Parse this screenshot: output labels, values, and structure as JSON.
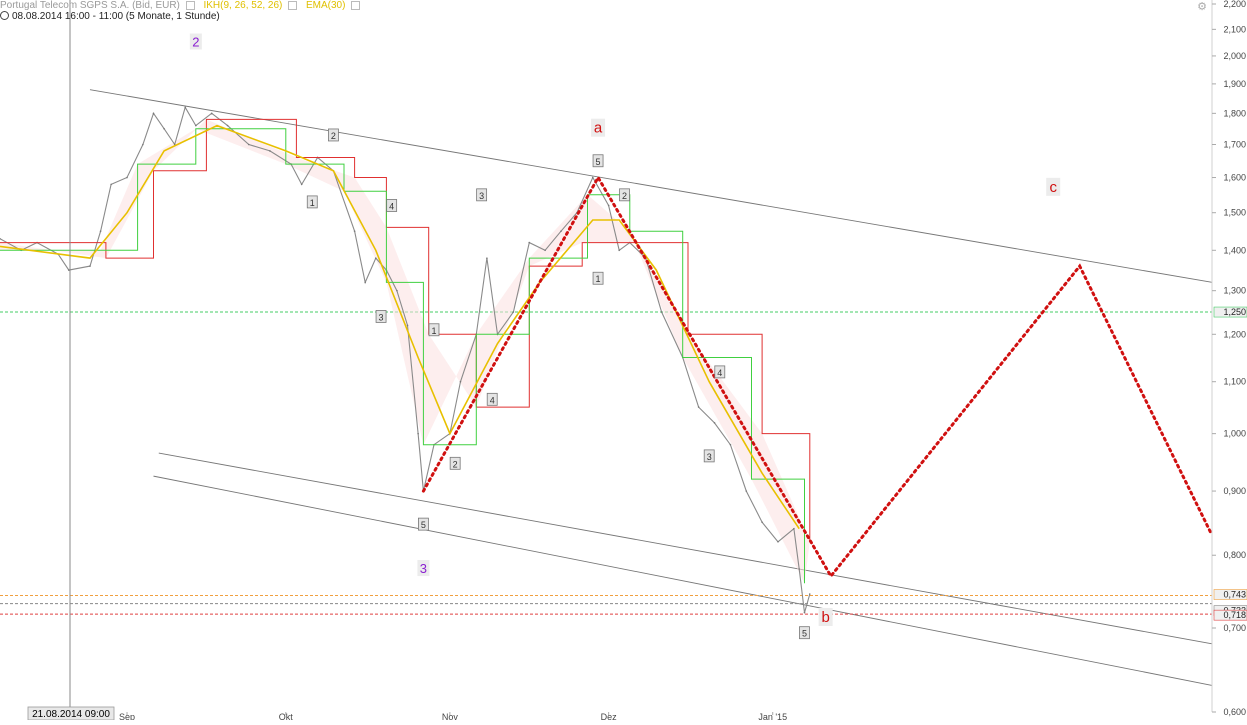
{
  "header": {
    "instrument": "Portugal Telecom SGPS S.A. (Bid, EUR)",
    "indicator_ikh": "IKH(9, 26, 52, 26)",
    "indicator_ema": "EMA(30)",
    "timeframe": "08.08.2014 16:00 - 11:00 (5 Monate, 1 Stunde)"
  },
  "cursor_date_label": "21.08.2014 09:00",
  "chart_data": {
    "type": "line",
    "title": "",
    "x_start": "2014-08-08",
    "x_end": "2015-03-25",
    "y_scale": "log",
    "ylim": [
      0.6,
      2.2
    ],
    "x_ticks": [
      {
        "date": "2014-09-01",
        "label": "Sep"
      },
      {
        "date": "2014-10-01",
        "label": "Okt"
      },
      {
        "date": "2014-11-01",
        "label": "Nov"
      },
      {
        "date": "2014-12-01",
        "label": "Dez"
      },
      {
        "date": "2015-01-01",
        "label": "Jan '15"
      }
    ],
    "y_ticks": [
      {
        "value": 0.6,
        "label": "0,600"
      },
      {
        "value": 0.7,
        "label": "0,700"
      },
      {
        "value": 0.8,
        "label": "0,800"
      },
      {
        "value": 0.9,
        "label": "0,900"
      },
      {
        "value": 1.0,
        "label": "1,000"
      },
      {
        "value": 1.1,
        "label": "1,100"
      },
      {
        "value": 1.2,
        "label": "1,200"
      },
      {
        "value": 1.3,
        "label": "1,300"
      },
      {
        "value": 1.4,
        "label": "1,400"
      },
      {
        "value": 1.5,
        "label": "1,500"
      },
      {
        "value": 1.6,
        "label": "1,600"
      },
      {
        "value": 1.7,
        "label": "1,700"
      },
      {
        "value": 1.8,
        "label": "1,800"
      },
      {
        "value": 1.9,
        "label": "1,900"
      },
      {
        "value": 2.0,
        "label": "2,000"
      },
      {
        "value": 2.1,
        "label": "2,100"
      },
      {
        "value": 2.2,
        "label": "2,200"
      }
    ],
    "price_series": [
      {
        "date": "2014-08-08",
        "value": 1.43
      },
      {
        "date": "2014-08-12",
        "value": 1.4
      },
      {
        "date": "2014-08-15",
        "value": 1.42
      },
      {
        "date": "2014-08-19",
        "value": 1.39
      },
      {
        "date": "2014-08-21",
        "value": 1.35
      },
      {
        "date": "2014-08-25",
        "value": 1.36
      },
      {
        "date": "2014-08-27",
        "value": 1.45
      },
      {
        "date": "2014-08-29",
        "value": 1.58
      },
      {
        "date": "2014-09-01",
        "value": 1.6
      },
      {
        "date": "2014-09-04",
        "value": 1.7
      },
      {
        "date": "2014-09-06",
        "value": 1.8
      },
      {
        "date": "2014-09-08",
        "value": 1.75
      },
      {
        "date": "2014-09-10",
        "value": 1.7
      },
      {
        "date": "2014-09-12",
        "value": 1.82
      },
      {
        "date": "2014-09-14",
        "value": 1.76
      },
      {
        "date": "2014-09-17",
        "value": 1.8
      },
      {
        "date": "2014-09-20",
        "value": 1.76
      },
      {
        "date": "2014-09-24",
        "value": 1.7
      },
      {
        "date": "2014-09-28",
        "value": 1.68
      },
      {
        "date": "2014-10-02",
        "value": 1.64
      },
      {
        "date": "2014-10-04",
        "value": 1.58
      },
      {
        "date": "2014-10-07",
        "value": 1.66
      },
      {
        "date": "2014-10-10",
        "value": 1.62
      },
      {
        "date": "2014-10-14",
        "value": 1.45
      },
      {
        "date": "2014-10-16",
        "value": 1.32
      },
      {
        "date": "2014-10-18",
        "value": 1.38
      },
      {
        "date": "2014-10-20",
        "value": 1.35
      },
      {
        "date": "2014-10-22",
        "value": 1.3
      },
      {
        "date": "2014-10-24",
        "value": 1.22
      },
      {
        "date": "2014-10-26",
        "value": 1.0
      },
      {
        "date": "2014-10-27",
        "value": 0.9
      },
      {
        "date": "2014-10-29",
        "value": 0.98
      },
      {
        "date": "2014-11-01",
        "value": 1.0
      },
      {
        "date": "2014-11-03",
        "value": 1.1
      },
      {
        "date": "2014-11-06",
        "value": 1.2
      },
      {
        "date": "2014-11-08",
        "value": 1.38
      },
      {
        "date": "2014-11-10",
        "value": 1.2
      },
      {
        "date": "2014-11-13",
        "value": 1.25
      },
      {
        "date": "2014-11-16",
        "value": 1.42
      },
      {
        "date": "2014-11-19",
        "value": 1.4
      },
      {
        "date": "2014-11-22",
        "value": 1.45
      },
      {
        "date": "2014-11-25",
        "value": 1.5
      },
      {
        "date": "2014-11-28",
        "value": 1.6
      },
      {
        "date": "2014-12-01",
        "value": 1.52
      },
      {
        "date": "2014-12-03",
        "value": 1.4
      },
      {
        "date": "2014-12-05",
        "value": 1.42
      },
      {
        "date": "2014-12-08",
        "value": 1.38
      },
      {
        "date": "2014-12-11",
        "value": 1.25
      },
      {
        "date": "2014-12-15",
        "value": 1.15
      },
      {
        "date": "2014-12-18",
        "value": 1.05
      },
      {
        "date": "2014-12-21",
        "value": 1.02
      },
      {
        "date": "2014-12-24",
        "value": 0.98
      },
      {
        "date": "2014-12-27",
        "value": 0.9
      },
      {
        "date": "2014-12-30",
        "value": 0.85
      },
      {
        "date": "2015-01-02",
        "value": 0.82
      },
      {
        "date": "2015-01-05",
        "value": 0.84
      },
      {
        "date": "2015-01-06",
        "value": 0.78
      },
      {
        "date": "2015-01-07",
        "value": 0.72
      },
      {
        "date": "2015-01-08",
        "value": 0.745
      }
    ],
    "ema_series": [
      {
        "date": "2014-08-08",
        "value": 1.41
      },
      {
        "date": "2014-08-25",
        "value": 1.38
      },
      {
        "date": "2014-09-01",
        "value": 1.5
      },
      {
        "date": "2014-09-08",
        "value": 1.68
      },
      {
        "date": "2014-09-18",
        "value": 1.76
      },
      {
        "date": "2014-10-01",
        "value": 1.68
      },
      {
        "date": "2014-10-10",
        "value": 1.62
      },
      {
        "date": "2014-10-18",
        "value": 1.4
      },
      {
        "date": "2014-10-26",
        "value": 1.15
      },
      {
        "date": "2014-11-01",
        "value": 1.0
      },
      {
        "date": "2014-11-10",
        "value": 1.18
      },
      {
        "date": "2014-11-18",
        "value": 1.32
      },
      {
        "date": "2014-11-28",
        "value": 1.48
      },
      {
        "date": "2014-12-03",
        "value": 1.48
      },
      {
        "date": "2014-12-10",
        "value": 1.35
      },
      {
        "date": "2014-12-20",
        "value": 1.1
      },
      {
        "date": "2014-12-30",
        "value": 0.93
      },
      {
        "date": "2015-01-06",
        "value": 0.84
      }
    ],
    "ikh_tenkan": [
      {
        "date": "2014-08-08",
        "value": 1.4
      },
      {
        "date": "2014-08-27",
        "value": 1.4
      },
      {
        "date": "2014-09-03",
        "value": 1.64
      },
      {
        "date": "2014-09-14",
        "value": 1.75
      },
      {
        "date": "2014-10-01",
        "value": 1.64
      },
      {
        "date": "2014-10-12",
        "value": 1.56
      },
      {
        "date": "2014-10-20",
        "value": 1.32
      },
      {
        "date": "2014-10-27",
        "value": 0.98
      },
      {
        "date": "2014-11-06",
        "value": 1.2
      },
      {
        "date": "2014-11-16",
        "value": 1.38
      },
      {
        "date": "2014-11-27",
        "value": 1.55
      },
      {
        "date": "2014-12-05",
        "value": 1.45
      },
      {
        "date": "2014-12-15",
        "value": 1.15
      },
      {
        "date": "2014-12-28",
        "value": 0.92
      },
      {
        "date": "2015-01-07",
        "value": 0.76
      }
    ],
    "ikh_kijun": [
      {
        "date": "2014-08-08",
        "value": 1.42
      },
      {
        "date": "2014-08-28",
        "value": 1.38
      },
      {
        "date": "2014-09-06",
        "value": 1.62
      },
      {
        "date": "2014-09-16",
        "value": 1.78
      },
      {
        "date": "2014-10-03",
        "value": 1.66
      },
      {
        "date": "2014-10-14",
        "value": 1.6
      },
      {
        "date": "2014-10-20",
        "value": 1.46
      },
      {
        "date": "2014-10-28",
        "value": 1.2
      },
      {
        "date": "2014-11-06",
        "value": 1.05
      },
      {
        "date": "2014-11-16",
        "value": 1.36
      },
      {
        "date": "2014-11-26",
        "value": 1.42
      },
      {
        "date": "2014-12-06",
        "value": 1.42
      },
      {
        "date": "2014-12-16",
        "value": 1.2
      },
      {
        "date": "2014-12-30",
        "value": 1.0
      },
      {
        "date": "2015-01-08",
        "value": 0.82
      }
    ],
    "horizontal_lines": [
      {
        "value": 1.25,
        "color": "#44cc66",
        "label": "1,250"
      },
      {
        "value": 0.743,
        "color": "#f0a040",
        "label": "0,743"
      },
      {
        "value": 0.732,
        "color": "#888888",
        "label": "0,732"
      },
      {
        "value": 0.718,
        "color": "#e04040",
        "label": "0,718"
      }
    ],
    "channel_lines": [
      {
        "from": {
          "date": "2014-08-25",
          "value": 1.88
        },
        "to": {
          "date": "2015-03-25",
          "value": 1.32
        }
      },
      {
        "from": {
          "date": "2014-09-07",
          "value": 0.965
        },
        "to": {
          "date": "2015-03-25",
          "value": 0.68
        }
      },
      {
        "from": {
          "date": "2014-09-06",
          "value": 0.925
        },
        "to": {
          "date": "2015-03-25",
          "value": 0.63
        }
      }
    ],
    "forecast_path": [
      {
        "date": "2014-10-27",
        "value": 0.9
      },
      {
        "date": "2014-11-29",
        "value": 1.6
      },
      {
        "date": "2015-01-12",
        "value": 0.77
      },
      {
        "date": "2015-02-28",
        "value": 1.36
      },
      {
        "date": "2015-03-25",
        "value": 0.83
      }
    ],
    "wave_labels": [
      {
        "text": "2",
        "date": "2014-09-14",
        "value": 2.05,
        "style": "purple"
      },
      {
        "text": "3",
        "date": "2014-10-27",
        "value": 0.78,
        "style": "purple"
      },
      {
        "text": "a",
        "date": "2014-11-29",
        "value": 1.75,
        "style": "red"
      },
      {
        "text": "b",
        "date": "2015-01-11",
        "value": 0.713,
        "style": "red"
      },
      {
        "text": "c",
        "date": "2015-02-23",
        "value": 1.57,
        "style": "red"
      },
      {
        "text": "1",
        "date": "2014-10-06",
        "value": 1.53,
        "style": "box"
      },
      {
        "text": "2",
        "date": "2014-10-10",
        "value": 1.73,
        "style": "box"
      },
      {
        "text": "3",
        "date": "2014-10-19",
        "value": 1.24,
        "style": "box"
      },
      {
        "text": "4",
        "date": "2014-10-21",
        "value": 1.52,
        "style": "box"
      },
      {
        "text": "5",
        "date": "2014-10-27",
        "value": 0.847,
        "style": "box"
      },
      {
        "text": "1",
        "date": "2014-10-29",
        "value": 1.21,
        "style": "box"
      },
      {
        "text": "2",
        "date": "2014-11-02",
        "value": 0.947,
        "style": "box"
      },
      {
        "text": "3",
        "date": "2014-11-07",
        "value": 1.55,
        "style": "box"
      },
      {
        "text": "4",
        "date": "2014-11-09",
        "value": 1.065,
        "style": "box"
      },
      {
        "text": "5",
        "date": "2014-11-29",
        "value": 1.65,
        "style": "box"
      },
      {
        "text": "1",
        "date": "2014-11-29",
        "value": 1.33,
        "style": "box"
      },
      {
        "text": "2",
        "date": "2014-12-04",
        "value": 1.55,
        "style": "box"
      },
      {
        "text": "3",
        "date": "2014-12-20",
        "value": 0.96,
        "style": "box"
      },
      {
        "text": "4",
        "date": "2014-12-22",
        "value": 1.12,
        "style": "box"
      },
      {
        "text": "5",
        "date": "2015-01-07",
        "value": 0.694,
        "style": "box"
      }
    ]
  }
}
